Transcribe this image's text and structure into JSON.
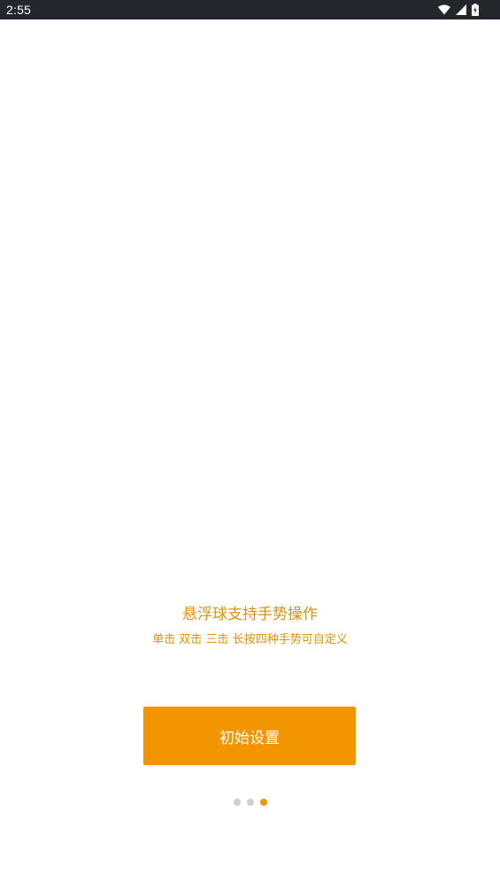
{
  "status_bar": {
    "time": "2:55",
    "icons": [
      "wifi-icon",
      "signal-icon",
      "battery-charging-icon"
    ]
  },
  "onboarding": {
    "title": "悬浮球支持手势操作",
    "subtitle": "单击 双击 三击 长按四种手势可自定义",
    "button_label": "初始设置",
    "pager": {
      "count": 3,
      "active_index": 2
    }
  },
  "colors": {
    "accent": "#f39501",
    "text_accent": "#e29100",
    "status_bar_bg": "#23262b",
    "dot_inactive": "#cfcfcf",
    "background": "#ffffff"
  }
}
